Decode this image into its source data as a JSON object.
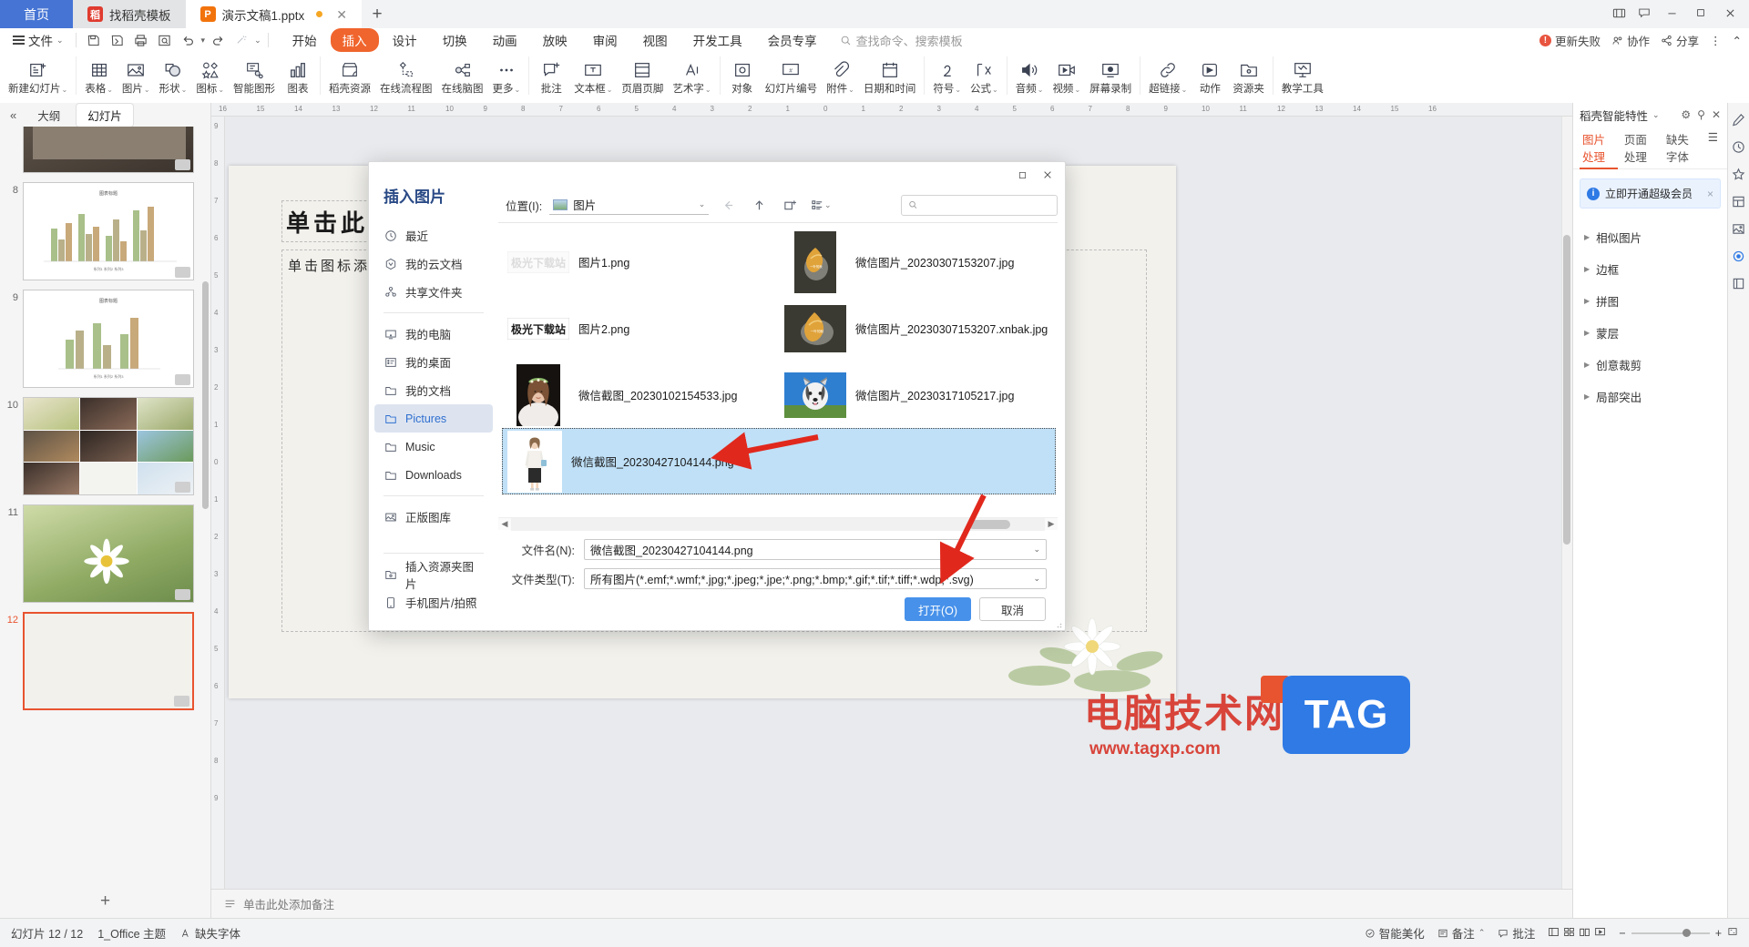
{
  "tabbar": {
    "home_label": "首页",
    "tabs": [
      {
        "label": "找稻壳模板",
        "icon": "docer-icon",
        "state": "inactive"
      },
      {
        "label": "演示文稿1.pptx",
        "icon": "ppt-icon",
        "state": "active",
        "modified": true
      }
    ],
    "add_label": "+",
    "right_icons": [
      "grid-view-icon",
      "comment-icon"
    ],
    "window_controls": [
      "minimize-icon",
      "maximize-icon",
      "close-icon"
    ]
  },
  "menurow": {
    "file_label": "文件",
    "quick_icons": [
      "save-icon",
      "save-as-icon",
      "print-icon",
      "print-preview-icon",
      "undo-icon",
      "redo-icon",
      "format-painter-icon",
      "customize-icon"
    ],
    "tabs": [
      {
        "label": "开始",
        "selected": false
      },
      {
        "label": "插入",
        "selected": true
      },
      {
        "label": "设计",
        "selected": false
      },
      {
        "label": "切换",
        "selected": false
      },
      {
        "label": "动画",
        "selected": false
      },
      {
        "label": "放映",
        "selected": false
      },
      {
        "label": "审阅",
        "selected": false
      },
      {
        "label": "视图",
        "selected": false
      },
      {
        "label": "开发工具",
        "selected": false
      },
      {
        "label": "会员专享",
        "selected": false
      }
    ],
    "search_placeholder": "查找命令、搜索模板",
    "right": [
      {
        "label": "更新失败",
        "icon": "alert-icon"
      },
      {
        "label": "协作",
        "icon": "collab-icon"
      },
      {
        "label": "分享",
        "icon": "share-icon"
      },
      {
        "label": "",
        "icon": "more-icon"
      },
      {
        "label": "",
        "icon": "collapse-ribbon-icon"
      }
    ]
  },
  "ribbon": {
    "groups": [
      [
        {
          "label": "新建幻灯片",
          "icon": "new-slide-icon",
          "caret": true
        }
      ],
      [
        {
          "label": "表格",
          "icon": "table-icon",
          "caret": true
        },
        {
          "label": "图片",
          "icon": "picture-icon",
          "caret": true
        },
        {
          "label": "形状",
          "icon": "shapes-icon",
          "caret": true
        },
        {
          "label": "图标",
          "icon": "icons-icon",
          "caret": true
        },
        {
          "label": "智能图形",
          "icon": "smartart-icon",
          "caret": false
        },
        {
          "label": "图表",
          "icon": "chart-icon",
          "caret": false
        }
      ],
      [
        {
          "label": "稻壳资源",
          "icon": "docer-shop-icon",
          "caret": false
        },
        {
          "label": "在线流程图",
          "icon": "flowchart-icon",
          "caret": false
        },
        {
          "label": "在线脑图",
          "icon": "mindmap-icon",
          "caret": false
        },
        {
          "label": "更多",
          "icon": "more-dots-icon",
          "caret": true
        }
      ],
      [
        {
          "label": "批注",
          "icon": "comment-add-icon",
          "caret": false
        },
        {
          "label": "文本框",
          "icon": "textbox-icon",
          "caret": true
        },
        {
          "label": "页眉页脚",
          "icon": "header-footer-icon",
          "caret": false
        },
        {
          "label": "艺术字",
          "icon": "wordart-icon",
          "caret": true
        }
      ],
      [
        {
          "label": "对象",
          "icon": "object-icon",
          "caret": false
        },
        {
          "label": "幻灯片编号",
          "icon": "slide-number-icon",
          "caret": false
        },
        {
          "label": "附件",
          "icon": "attachment-icon",
          "caret": true
        },
        {
          "label": "日期和时间",
          "icon": "datetime-icon",
          "caret": false
        }
      ],
      [
        {
          "label": "符号",
          "icon": "symbol-icon",
          "caret": true
        },
        {
          "label": "公式",
          "icon": "formula-icon",
          "caret": true
        }
      ],
      [
        {
          "label": "音频",
          "icon": "audio-icon",
          "caret": true
        },
        {
          "label": "视频",
          "icon": "video-icon",
          "caret": true
        },
        {
          "label": "屏幕录制",
          "icon": "screen-record-icon",
          "caret": false
        }
      ],
      [
        {
          "label": "超链接",
          "icon": "hyperlink-icon",
          "caret": true
        },
        {
          "label": "动作",
          "icon": "action-icon",
          "caret": false
        },
        {
          "label": "资源夹",
          "icon": "resource-folder-icon",
          "caret": false
        }
      ],
      [
        {
          "label": "教学工具",
          "icon": "teaching-tools-icon",
          "caret": false
        }
      ]
    ]
  },
  "leftpanel": {
    "collapse_icon": "collapse-left-icon",
    "tabs": [
      {
        "label": "大纲",
        "selected": false
      },
      {
        "label": "幻灯片",
        "selected": true
      }
    ],
    "slides": [
      {
        "number": "8"
      },
      {
        "number": "9"
      },
      {
        "number": "10"
      },
      {
        "number": "11"
      },
      {
        "number": "12",
        "selected": true
      }
    ],
    "add_slide_label": "+"
  },
  "canvas": {
    "ruler_h": [
      "16",
      "15",
      "14",
      "13",
      "12",
      "11",
      "10",
      "9",
      "8",
      "7",
      "6",
      "5",
      "4",
      "3",
      "2",
      "1",
      "0",
      "1",
      "2",
      "3",
      "4",
      "5",
      "6",
      "7",
      "8",
      "9",
      "10",
      "11",
      "12",
      "13",
      "14",
      "15",
      "16"
    ],
    "ruler_v": [
      "9",
      "8",
      "7",
      "6",
      "5",
      "4",
      "3",
      "2",
      "1",
      "0",
      "1",
      "2",
      "3",
      "4",
      "5",
      "6",
      "7",
      "8",
      "9"
    ],
    "title_placeholder": "单击此处编辑母版标题样式",
    "body_placeholder": "单击图标添加图片",
    "notes_placeholder": "单击此处添加备注"
  },
  "rightpanel": {
    "title": "稻壳智能特性",
    "head_icons": [
      "gear-icon",
      "pin-icon",
      "close-icon"
    ],
    "tabs": [
      {
        "label": "图片处理",
        "selected": true
      },
      {
        "label": "页面处理",
        "selected": false
      },
      {
        "label": "缺失字体",
        "selected": false
      }
    ],
    "menu_icon": "list-menu-icon",
    "banner": {
      "text": "立即开通超级会员",
      "icon": "info-icon",
      "close": "×"
    },
    "rows": [
      {
        "label": "相似图片"
      },
      {
        "label": "边框"
      },
      {
        "label": "拼图"
      },
      {
        "label": "蒙层"
      },
      {
        "label": "创意裁剪"
      },
      {
        "label": "局部突出"
      }
    ],
    "rail_icons": [
      "pen-icon",
      "history-icon",
      "star-icon",
      "layout-icon",
      "image-tool-icon",
      "smart-feature-icon",
      "widget-icon"
    ]
  },
  "dialog": {
    "title": "插入图片",
    "titlebar_buttons": [
      "maximize-icon",
      "close-icon"
    ],
    "sidebar": [
      {
        "label": "最近",
        "icon": "clock-icon",
        "selected": false
      },
      {
        "label": "我的云文档",
        "icon": "cloud-icon",
        "selected": false
      },
      {
        "label": "共享文件夹",
        "icon": "share-folder-icon",
        "selected": false
      },
      {
        "divider": true
      },
      {
        "label": "我的电脑",
        "icon": "computer-icon",
        "selected": false
      },
      {
        "label": "我的桌面",
        "icon": "desktop-icon",
        "selected": false
      },
      {
        "label": "我的文档",
        "icon": "folder-icon",
        "selected": false
      },
      {
        "label": "Pictures",
        "icon": "folder-icon",
        "selected": true
      },
      {
        "label": "Music",
        "icon": "folder-icon",
        "selected": false
      },
      {
        "label": "Downloads",
        "icon": "folder-icon",
        "selected": false
      },
      {
        "divider": true
      },
      {
        "label": "正版图库",
        "icon": "gallery-icon",
        "selected": false
      },
      {
        "divider": true
      },
      {
        "label": "插入资源夹图片",
        "icon": "resource-folder-icon",
        "selected": false
      },
      {
        "label": "手机图片/拍照",
        "icon": "phone-photo-icon",
        "selected": false
      }
    ],
    "location": {
      "label": "位置(I):",
      "value": "图片",
      "icon": "picture-folder-icon",
      "caret": "⌄"
    },
    "nav_icons": [
      "back-icon",
      "up-icon",
      "new-folder-icon",
      "view-mode-icon"
    ],
    "search": {
      "placeholder": "",
      "value": "",
      "icon": "search-icon"
    },
    "files": [
      {
        "name": "图片1.png",
        "thumb": "watermark-faded",
        "selected": false
      },
      {
        "name": "微信图片_20230307153207.jpg",
        "thumb": "leaf-tall",
        "selected": false
      },
      {
        "name": "图片2.png",
        "thumb": "watermark-bold",
        "selected": false
      },
      {
        "name": "微信图片_20230307153207.xnbak.jpg",
        "thumb": "leaf-wide",
        "selected": false
      },
      {
        "name": "微信截图_20230102154533.jpg",
        "thumb": "bride-portrait",
        "selected": false
      },
      {
        "name": "微信图片_20230317105217.jpg",
        "thumb": "husky-dog",
        "selected": false
      },
      {
        "name": "微信截图_20230427104144.png",
        "thumb": "fashion-girl",
        "selected": true
      }
    ],
    "filename": {
      "label": "文件名(N):",
      "value": "微信截图_20230427104144.png"
    },
    "filetype": {
      "label": "文件类型(T):",
      "value": "所有图片(*.emf;*.wmf;*.jpg;*.jpeg;*.jpe;*.png;*.bmp;*.gif;*.tif;*.tiff;*.wdp;*.svg)"
    },
    "buttons": {
      "open": "打开(O)",
      "cancel": "取消"
    }
  },
  "statusbar": {
    "slide_count": "幻灯片 12 / 12",
    "theme": "1_Office 主题",
    "missing_font": "缺失字体",
    "right": [
      {
        "label": "智能美化",
        "icon": "beautify-icon"
      },
      {
        "label": "备注",
        "icon": "note-icon"
      },
      {
        "label": "批注",
        "icon": "comment-icon"
      }
    ],
    "view_icons": [
      "normal-view-icon",
      "sorter-view-icon",
      "reading-view-icon",
      "slideshow-icon"
    ],
    "zoom": {
      "value": "",
      "minus": "−",
      "plus": "+",
      "fit": "fit-icon"
    }
  },
  "watermark": {
    "cn": "电脑技术网",
    "url": "www.tagxp.com",
    "tag": "TAG"
  },
  "colors": {
    "accent_orange": "#f0652d",
    "accent_blue": "#4791ea",
    "home_blue": "#4574d4",
    "dialog_title_blue": "#2a4a86",
    "selection_blue": "#bfe0f7",
    "arrow_red": "#e1281d"
  }
}
